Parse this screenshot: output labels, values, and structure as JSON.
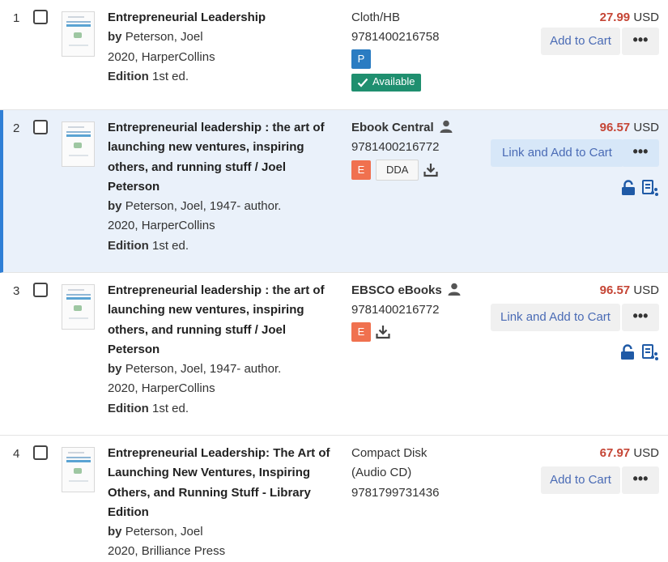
{
  "results": [
    {
      "num": "1",
      "title": "Entrepreneurial Leadership",
      "by_label": "by",
      "author": "Peterson, Joel",
      "pub": "2020, HarperCollins",
      "edition_label": "Edition",
      "edition": "1st ed.",
      "format": "Cloth/HB",
      "isbn": "9781400216758",
      "badge": "P",
      "status": "Available",
      "price": "27.99",
      "currency": "USD",
      "button": "Add to Cart",
      "more": "•••"
    },
    {
      "num": "2",
      "title": "Entrepreneurial leadership : the art of launching new ventures, inspiring others, and running stuff / Joel Peterson",
      "by_label": "by",
      "author": "Peterson, Joel, 1947- author.",
      "pub": "2020, HarperCollins",
      "edition_label": "Edition",
      "edition": "1st ed.",
      "format": "Ebook Central",
      "isbn": "9781400216772",
      "badge": "E",
      "dda": "DDA",
      "price": "96.57",
      "currency": "USD",
      "button": "Link and Add to Cart",
      "more": "•••"
    },
    {
      "num": "3",
      "title": "Entrepreneurial leadership : the art of launching new ventures, inspiring others, and running stuff / Joel Peterson",
      "by_label": "by",
      "author": "Peterson, Joel, 1947- author.",
      "pub": "2020, HarperCollins",
      "edition_label": "Edition",
      "edition": "1st ed.",
      "format": "EBSCO eBooks",
      "isbn": "9781400216772",
      "badge": "E",
      "price": "96.57",
      "currency": "USD",
      "button": "Link and Add to Cart",
      "more": "•••"
    },
    {
      "num": "4",
      "title": "Entrepreneurial Leadership: The Art of Launching New Ventures, Inspiring Others, and Running Stuff - Library Edition",
      "by_label": "by",
      "author": "Peterson, Joel",
      "pub": "2020, Brilliance Press",
      "format": "Compact Disk (Audio CD)",
      "isbn": "9781799731436",
      "price": "67.97",
      "currency": "USD",
      "button": "Add to Cart",
      "more": "•••"
    }
  ]
}
